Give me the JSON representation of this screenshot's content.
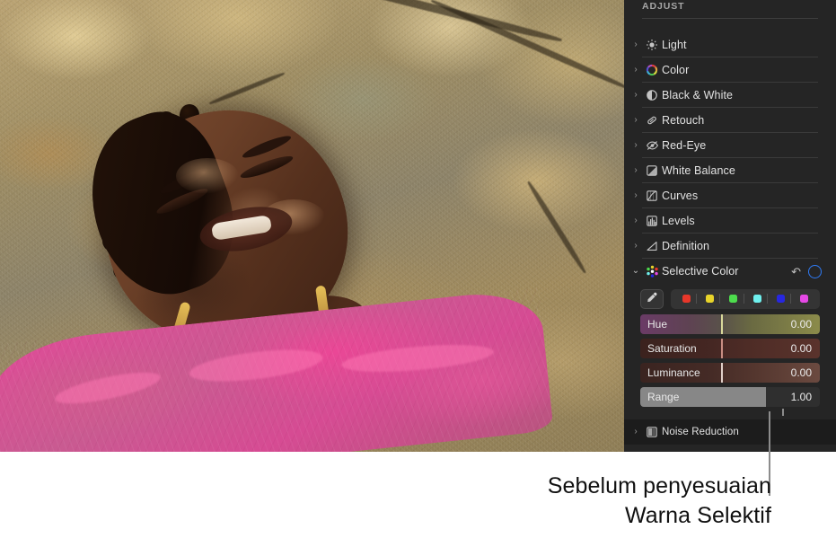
{
  "photo": {
    "alt_description": "Woman with braided hair lying on sunlit rock wearing a pink sheer top",
    "subject_clothing_color": "#e04b97",
    "rock_base_color": "#9d8c62"
  },
  "panel": {
    "title": "ADJUST",
    "background_color": "#252525",
    "accent_color": "#2f7bf6",
    "rows": [
      {
        "label": "Light",
        "icon": "sun-icon",
        "expanded": false,
        "chevron": "›"
      },
      {
        "label": "Color",
        "icon": "color-wheel-icon",
        "expanded": false,
        "chevron": "›"
      },
      {
        "label": "Black & White",
        "icon": "half-circle-icon",
        "expanded": false,
        "chevron": "›"
      },
      {
        "label": "Retouch",
        "icon": "retouch-brush-icon",
        "expanded": false,
        "chevron": "›"
      },
      {
        "label": "Red-Eye",
        "icon": "eye-slash-icon",
        "expanded": false,
        "chevron": "›"
      },
      {
        "label": "White Balance",
        "icon": "white-balance-icon",
        "expanded": false,
        "chevron": "›"
      },
      {
        "label": "Curves",
        "icon": "curves-icon",
        "expanded": false,
        "chevron": "›"
      },
      {
        "label": "Levels",
        "icon": "levels-icon",
        "expanded": false,
        "chevron": "›"
      },
      {
        "label": "Definition",
        "icon": "definition-icon",
        "expanded": false,
        "chevron": "›"
      }
    ],
    "selective_color": {
      "label": "Selective Color",
      "icon": "color-dots-icon",
      "chevron": "⌄",
      "expanded": true,
      "reset_icon": "reset-arrow-icon",
      "reset_glyph": "↶",
      "toggle_icon": "enable-circle-icon",
      "eyedropper_icon": "eyedropper-icon",
      "swatches": [
        {
          "name": "swatch-red",
          "color": "#e8372a"
        },
        {
          "name": "swatch-yellow",
          "color": "#e8d42a"
        },
        {
          "name": "swatch-green",
          "color": "#4ddc4d"
        },
        {
          "name": "swatch-cyan",
          "color": "#6ff0ee"
        },
        {
          "name": "swatch-blue",
          "color": "#2727e0"
        },
        {
          "name": "swatch-magenta",
          "color": "#e548e5"
        }
      ],
      "sliders": [
        {
          "label": "Hue",
          "value": "0.00",
          "thumb_pct": 45,
          "gradient": "linear-gradient(90deg,#6a3b66 0%,#5e4352 28%,#59514a 45%,#6a6a42 62%,#8b8b4a 100%)",
          "thumb_color": "#d8d89a"
        },
        {
          "label": "Saturation",
          "value": "0.00",
          "thumb_pct": 45,
          "gradient": "linear-gradient(90deg,#3b221e 0%,#452723 40%,#4e2c26 60%,#5a332c 100%)",
          "thumb_color": "#c78d82"
        },
        {
          "label": "Luminance",
          "value": "0.00",
          "thumb_pct": 45,
          "gradient": "linear-gradient(90deg,#3a2420 0%,#452b26 40%,#55372f 65%,#6b4a40 100%)",
          "thumb_color": "#e0cfc8"
        },
        {
          "label": "Range",
          "value": "1.00",
          "thumb_pct": 70,
          "gradient": "linear-gradient(90deg,#8c8c8c 0%,#8c8c8c 100%)",
          "thumb_color": "#8c8c8c",
          "style": "fill"
        }
      ]
    },
    "noise_reduction": {
      "label": "Noise Reduction",
      "icon": "noise-reduction-icon",
      "chevron": "›"
    }
  },
  "caption": {
    "line1": "Sebelum penyesuaian",
    "line2": "Warna Selektif",
    "callout_color": "#8c8c8c",
    "text_color": "#111111"
  }
}
